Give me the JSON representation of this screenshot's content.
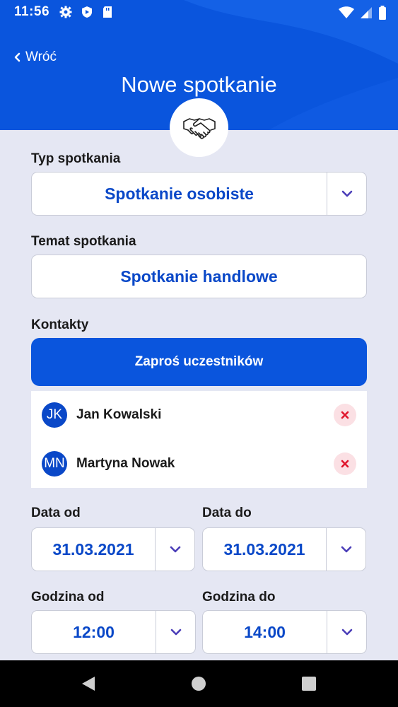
{
  "status_bar": {
    "time": "11:56",
    "icons_left": [
      "gear-icon",
      "shield-icon",
      "sd-card-icon"
    ],
    "icons_right": [
      "wifi-icon",
      "signal-icon",
      "battery-icon"
    ]
  },
  "header": {
    "back_label": "Wróć",
    "title": "Nowe spotkanie",
    "logo_icon": "handshake-icon",
    "background_color": "#0a55dd"
  },
  "form": {
    "meeting_type": {
      "label": "Typ spotkania",
      "value": "Spotkanie osobiste"
    },
    "meeting_topic": {
      "label": "Temat spotkania",
      "value": "Spotkanie handlowe"
    },
    "contacts": {
      "label": "Kontakty",
      "invite_button": "Zaproś uczestników",
      "items": [
        {
          "initials": "JK",
          "name": "Jan Kowalski"
        },
        {
          "initials": "MN",
          "name": "Martyna Nowak"
        }
      ]
    },
    "date_from": {
      "label": "Data od",
      "value": "31.03.2021"
    },
    "date_to": {
      "label": "Data do",
      "value": "31.03.2021"
    },
    "time_from": {
      "label": "Godzina od",
      "value": "12:00"
    },
    "time_to": {
      "label": "Godzina do",
      "value": "14:00"
    }
  },
  "colors": {
    "accent": "#0a55dd",
    "value_text": "#0a48c8",
    "remove_bg": "#fbe0e4",
    "remove_x": "#e0152c"
  },
  "nav_bar": {
    "buttons": [
      "back-triangle-icon",
      "home-circle-icon",
      "recents-square-icon"
    ]
  }
}
